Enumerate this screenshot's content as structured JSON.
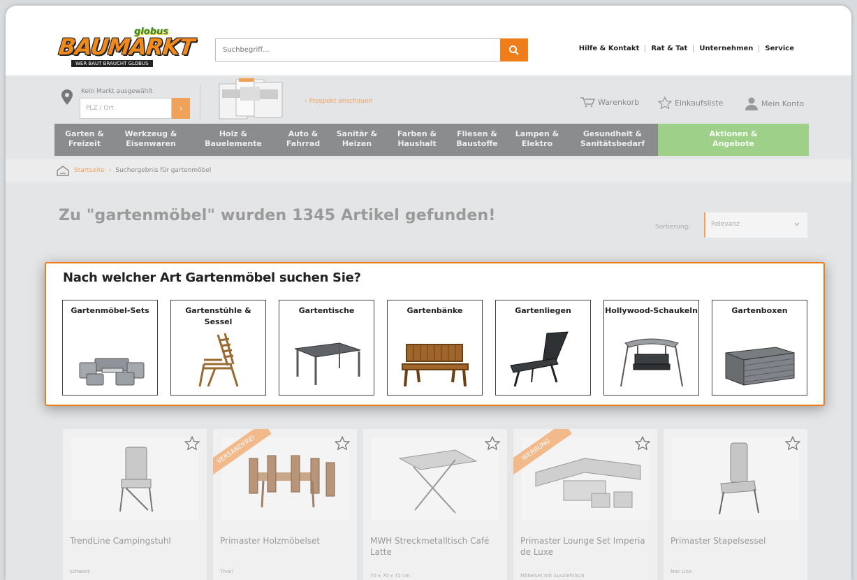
{
  "header": {
    "logo_text": "BAUMARKT",
    "logo_brand": "globus",
    "logo_tagline": "WER BAUT BRAUCHT GLOBUS",
    "search_placeholder": "Suchbegriff...",
    "links": [
      "Hilfe & Kontakt",
      "Rat & Tat",
      "Unternehmen",
      "Service"
    ]
  },
  "subheader": {
    "market_label": "Kein Markt ausgewählt",
    "plz_placeholder": "PLZ / Ort",
    "market_go": "›",
    "prospekt_link": "› Prospekt anschauen",
    "cart": "Warenkorb",
    "wishlist": "Einkaufsliste",
    "account": "Mein Konto"
  },
  "nav": {
    "items": [
      {
        "l1": "Garten &",
        "l2": "Freizeit"
      },
      {
        "l1": "Werkzeug &",
        "l2": "Eisenwaren"
      },
      {
        "l1": "Holz &",
        "l2": "Bauelemente"
      },
      {
        "l1": "Auto &",
        "l2": "Fahrrad"
      },
      {
        "l1": "Sanitär &",
        "l2": "Heizen"
      },
      {
        "l1": "Farben &",
        "l2": "Haushalt"
      },
      {
        "l1": "Fliesen &",
        "l2": "Baustoffe"
      },
      {
        "l1": "Lampen &",
        "l2": "Elektro"
      },
      {
        "l1": "Gesundheit &",
        "l2": "Sanitätsbedarf"
      },
      {
        "l1": "Aktionen &",
        "l2": "Angebote"
      }
    ]
  },
  "breadcrumb": {
    "home": "Startseite",
    "sep": "›",
    "current": "Suchergebnis für gartenmöbel"
  },
  "results": {
    "title": "Zu \"gartenmöbel\" wurden 1345 Artikel gefunden!",
    "sort_label": "Sortierung:",
    "sort_value": "Relevanz"
  },
  "category_panel": {
    "question": "Nach welcher Art Gartenmöbel suchen Sie?",
    "categories": [
      {
        "name": "Gartenmöbel-Sets",
        "icon": "furniture-set-icon"
      },
      {
        "name": "Gartenstühle & Sessel",
        "icon": "garden-chair-icon"
      },
      {
        "name": "Gartentische",
        "icon": "garden-table-icon"
      },
      {
        "name": "Gartenbänke",
        "icon": "garden-bench-icon"
      },
      {
        "name": "Gartenliegen",
        "icon": "sun-lounger-icon"
      },
      {
        "name": "Hollywood-Schaukeln",
        "icon": "swing-icon"
      },
      {
        "name": "Gartenboxen",
        "icon": "storage-box-icon"
      }
    ]
  },
  "products": [
    {
      "name": "TrendLine Campingstuhl",
      "sub": "schwarz",
      "ribbon": ""
    },
    {
      "name": "Primaster Holzmöbelset",
      "sub": "Tivoli",
      "ribbon": "VERSANDFREI"
    },
    {
      "name": "MWH Streckmetalltisch Café Latte",
      "sub": "70 x 70 x 72 cm",
      "ribbon": ""
    },
    {
      "name": "Primaster Lounge Set Imperia de Luxe",
      "sub": "Möbelset mit Ausziehtisch",
      "ribbon": "WERBUNG"
    },
    {
      "name": "Primaster Stapelsessel",
      "sub": "Nox Line",
      "ribbon": ""
    }
  ],
  "colors": {
    "accent": "#ef7d1a",
    "promo": "#9fd08a",
    "nav_bg": "#8a8c8e"
  }
}
